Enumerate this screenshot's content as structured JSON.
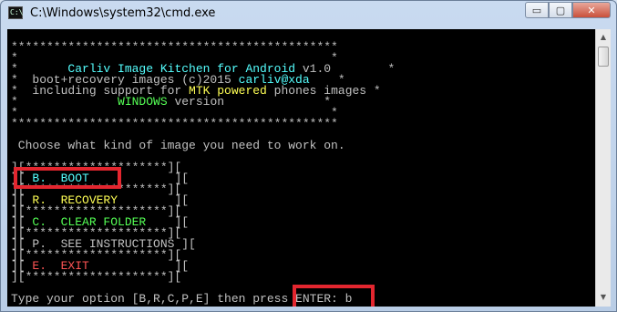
{
  "window": {
    "title": "C:\\Windows\\system32\\cmd.exe",
    "minimize_label": "▭",
    "maximize_label": "▢",
    "close_label": "✕"
  },
  "console": {
    "lines": {
      "star_top": "**********************************************",
      "blank1": "*                                            *",
      "t_pre": "*       ",
      "t_app": "Carliv Image Kitchen for Android",
      "t_ver": " v1.0",
      "t_post": "        *",
      "c_pre": "*  boot+recovery images (c)2015 ",
      "c_user": "carliv@xda",
      "c_post": "    *",
      "s_pre": "*  including support for ",
      "s_mtk": "MTK powered",
      "s_post": " phones images *",
      "w_pre": "*              ",
      "w_win": "WINDOWS",
      "w_post": " version              *",
      "blank2": "*                                            *",
      "star_bottom": "**********************************************",
      "prompt_title": " Choose what kind of image you need to work on.",
      "m_sep1": "][********************][",
      "m_b_pre": "][ ",
      "m_b": "B.  BOOT",
      "m_b_post": "            ][",
      "m_sep2": "][********************][",
      "m_r_pre": "][ ",
      "m_r": "R.  RECOVERY",
      "m_r_post": "        ][",
      "m_sep3": "][********************][",
      "m_c_pre": "][ ",
      "m_c": "C.  CLEAR FOLDER",
      "m_c_post": "    ][",
      "m_sep4": "][********************][",
      "m_p": "][ P.  SEE INSTRUCTIONS ][",
      "m_sep5": "][********************][",
      "m_e_pre": "][ ",
      "m_e": "E.  EXIT",
      "m_e_post": "            ][",
      "m_sep6": "][********************][",
      "input_prompt": "Type your option [B,R,C,P,E] then press ENTER: ",
      "input_value": "b"
    }
  },
  "colors": {
    "console_bg": "#000000",
    "cyan": "#55ffff",
    "yellow": "#ffff55",
    "green": "#55ff55",
    "red": "#ff5555",
    "gray": "#c0c0c0",
    "highlight_box": "#e3262f"
  },
  "icons": {
    "title_icon": "cmd-icon",
    "scroll_up": "scroll-up-icon",
    "scroll_down": "scroll-down-icon"
  }
}
